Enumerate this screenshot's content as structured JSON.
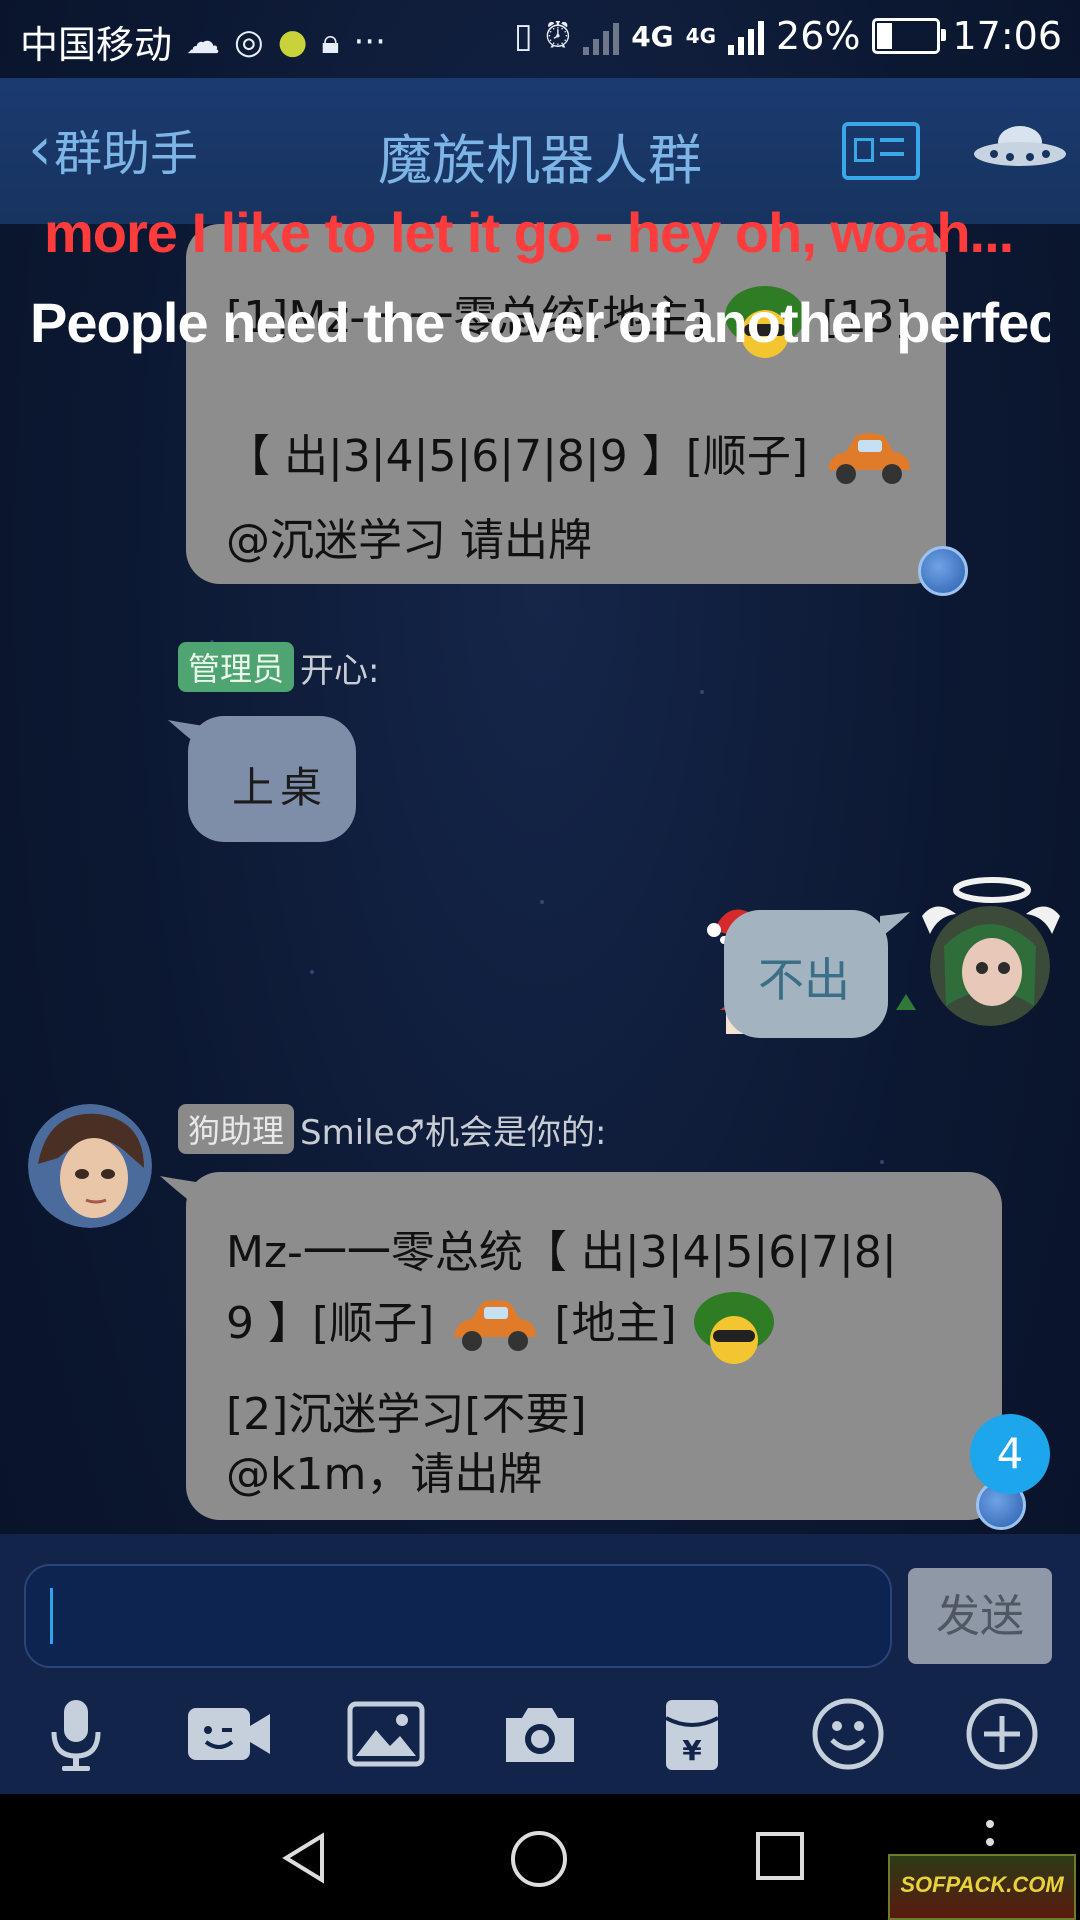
{
  "status_bar": {
    "carrier": "中国移动",
    "network_1": "4G",
    "network_2": "4G",
    "battery": "26%",
    "battery_level": 0.26,
    "time": "17:06",
    "more": "···"
  },
  "header": {
    "back_label": "群助手",
    "title": "魔族机器人群"
  },
  "lyrics": {
    "line1": "more I like to let it go - hey oh, woah...",
    "line2": "People need the cover of another perfect"
  },
  "messages": {
    "m1": {
      "line1": "[1]Mz-一一零总统[地主]",
      "line1_suffix": "[13]",
      "line2": "【 出|3|4|5|6|7|8|9 】[顺子]",
      "line3": "@沉迷学习 请出牌"
    },
    "m2": {
      "badge": "管理员",
      "sender": "开心:",
      "text": "上桌"
    },
    "m3": {
      "text": "不出"
    },
    "m4": {
      "badge": "狗助理",
      "sender": "Smile♂机会是你的:",
      "line1": "Mz-一一零总统【 出|3|4|5|6|7|8|",
      "line2a": "9 】[顺子]",
      "line2b": "[地主]",
      "line3": "[2]沉迷学习[不要]",
      "line4": "@k1m，请出牌"
    }
  },
  "unread_count": "4",
  "input": {
    "value": "",
    "send_label": "发送"
  },
  "toolbar_icons": [
    "microphone-icon",
    "video-call-icon",
    "image-icon",
    "camera-icon",
    "red-packet-icon",
    "emoji-icon",
    "plus-icon"
  ],
  "watermark": "SOFPACK.COM",
  "colors": {
    "header_text": "#7db5e6",
    "bubble_gray": "#8d8d8d",
    "admin_badge": "#4fa572",
    "unread": "#1ea6ec",
    "lyric1": "#ff3b3b"
  }
}
